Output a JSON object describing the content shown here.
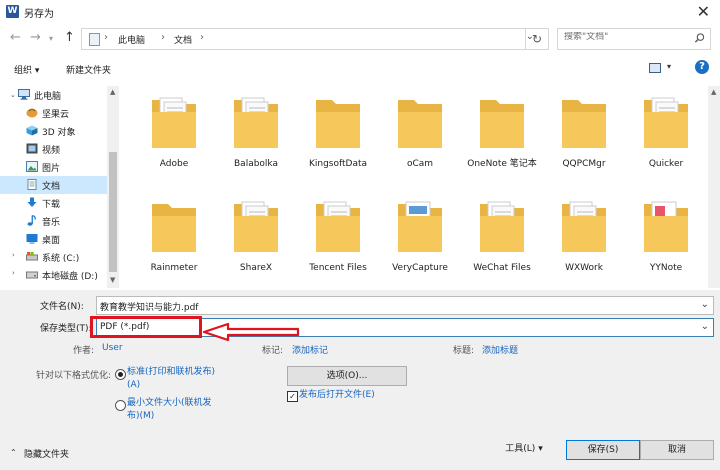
{
  "window": {
    "title": "另存为",
    "app_icon_letter": "W"
  },
  "address": {
    "crumbs": [
      "此电脑",
      "文档"
    ],
    "search_placeholder": "搜索\"文档\""
  },
  "toolbar": {
    "organize": "组织 ▾",
    "new_folder": "新建文件夹"
  },
  "nav": {
    "items": [
      {
        "label": "此电脑",
        "icon": "computer-icon",
        "selected": false
      },
      {
        "label": "坚果云",
        "icon": "nut-cloud-icon",
        "selected": false
      },
      {
        "label": "3D 对象",
        "icon": "3d-objects-icon",
        "selected": false
      },
      {
        "label": "视频",
        "icon": "video-icon",
        "selected": false
      },
      {
        "label": "图片",
        "icon": "pictures-icon",
        "selected": false
      },
      {
        "label": "文档",
        "icon": "documents-icon",
        "selected": true
      },
      {
        "label": "下载",
        "icon": "downloads-icon",
        "selected": false
      },
      {
        "label": "音乐",
        "icon": "music-icon",
        "selected": false
      },
      {
        "label": "桌面",
        "icon": "desktop-icon",
        "selected": false
      },
      {
        "label": "系统 (C:)",
        "icon": "drive-c-icon",
        "selected": false
      },
      {
        "label": "本地磁盘 (D:)",
        "icon": "drive-d-icon",
        "selected": false
      }
    ]
  },
  "files": [
    {
      "name": "Adobe",
      "type": "docs"
    },
    {
      "name": "Balabolka",
      "type": "docs"
    },
    {
      "name": "KingsoftData",
      "type": "plain"
    },
    {
      "name": "oCam",
      "type": "plain"
    },
    {
      "name": "OneNote 笔记本",
      "type": "plain"
    },
    {
      "name": "QQPCMgr",
      "type": "plain"
    },
    {
      "name": "Quicker",
      "type": "docs"
    },
    {
      "name": "Rainmeter",
      "type": "plain"
    },
    {
      "name": "ShareX",
      "type": "docs"
    },
    {
      "name": "Tencent Files",
      "type": "docs"
    },
    {
      "name": "VeryCapture",
      "type": "screens"
    },
    {
      "name": "WeChat Files",
      "type": "docs"
    },
    {
      "name": "WXWork",
      "type": "docs"
    },
    {
      "name": "YYNote",
      "type": "red"
    }
  ],
  "form": {
    "filename_label": "文件名(N):",
    "filename_value": "教育教学知识与能力.pdf",
    "filetype_label": "保存类型(T):",
    "filetype_value": "PDF (*.pdf)",
    "author_label": "作者:",
    "author_value": "User",
    "tags_label": "标记:",
    "tags_value": "添加标记",
    "title_label": "标题:",
    "title_value": "添加标题",
    "optimize_label": "针对以下格式优化:",
    "opt_standard": [
      "标准(打印和联机发布)",
      "(A)"
    ],
    "opt_minimum": [
      "最小文件大小(联机发",
      "布)(M)"
    ],
    "options_button": "选项(O)...",
    "open_after_label": "发布后打开文件(E)",
    "hide_folders": "隐藏文件夹",
    "tools_button": "工具(L)",
    "save_button": "保存(S)",
    "cancel_button": "取消"
  },
  "colors": {
    "accent": "#0078d7",
    "highlight": "#e0141e",
    "folder": "#f6c75a",
    "selection": "#cce8ff"
  }
}
